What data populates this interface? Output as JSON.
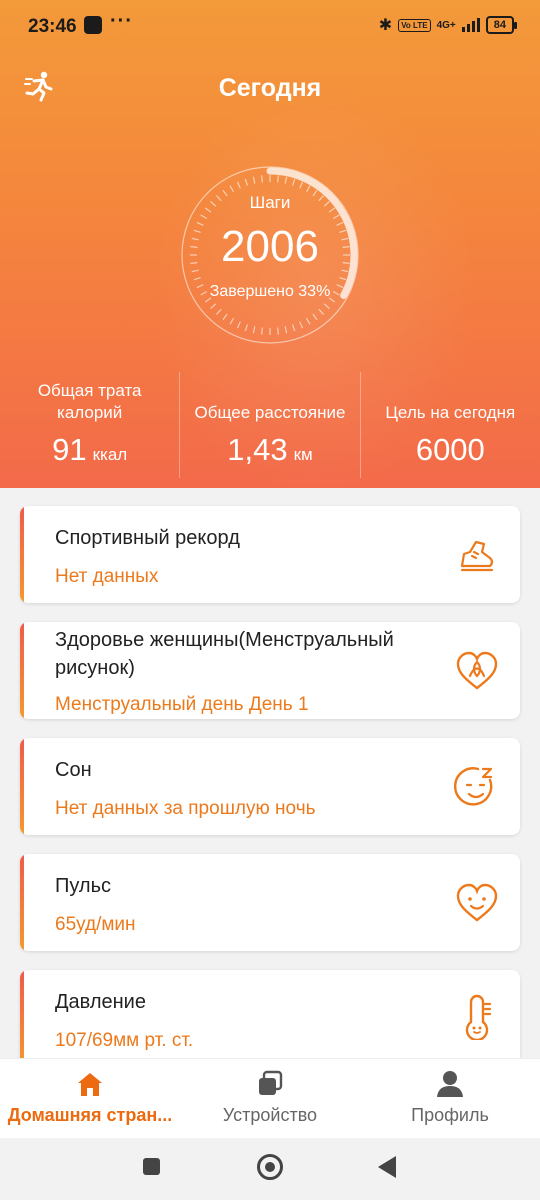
{
  "status_bar": {
    "time": "23:46",
    "dots": "···",
    "volte": "Vo LTE",
    "network": "4G+",
    "battery": "84"
  },
  "header": {
    "title": "Сегодня",
    "runner_icon": "runner-icon"
  },
  "steps": {
    "label": "Шаги",
    "value": "2006",
    "progress_text": "Завершено 33%",
    "progress_fraction": 0.33
  },
  "stats": [
    {
      "label": "Общая трата калорий",
      "value": "91",
      "unit": "ккал"
    },
    {
      "label": "Общее расстояние",
      "value": "1,43",
      "unit": "км"
    },
    {
      "label": "Цель на сегодня",
      "value": "6000",
      "unit": ""
    }
  ],
  "cards": [
    {
      "title": "Спортивный рекорд",
      "subtitle": "Нет данных",
      "icon": "shoe-icon"
    },
    {
      "title": "Здоровье женщины(Менструальный рисунок)",
      "subtitle": "Менструальный день День 1",
      "icon": "heart-ribbon-icon"
    },
    {
      "title": "Сон",
      "subtitle": "Нет данных за прошлую ночь",
      "icon": "sleep-face-icon"
    },
    {
      "title": "Пульс",
      "subtitle": "65уд/мин",
      "icon": "heart-face-icon"
    },
    {
      "title": "Давление",
      "subtitle": "107/69мм рт. ст.",
      "icon": "thermometer-face-icon"
    }
  ],
  "bottom_nav": [
    {
      "label": "Домашняя стран...",
      "icon": "home-icon",
      "active": true
    },
    {
      "label": "Устройство",
      "icon": "device-icon",
      "active": false
    },
    {
      "label": "Профиль",
      "icon": "profile-icon",
      "active": false
    }
  ],
  "colors": {
    "accent": "#ec7a1c",
    "hero_top": "#f39a3a",
    "hero_bottom": "#f36a4a",
    "card_bar_top": "#f05a4a",
    "card_bar_bottom": "#f39a2e"
  }
}
